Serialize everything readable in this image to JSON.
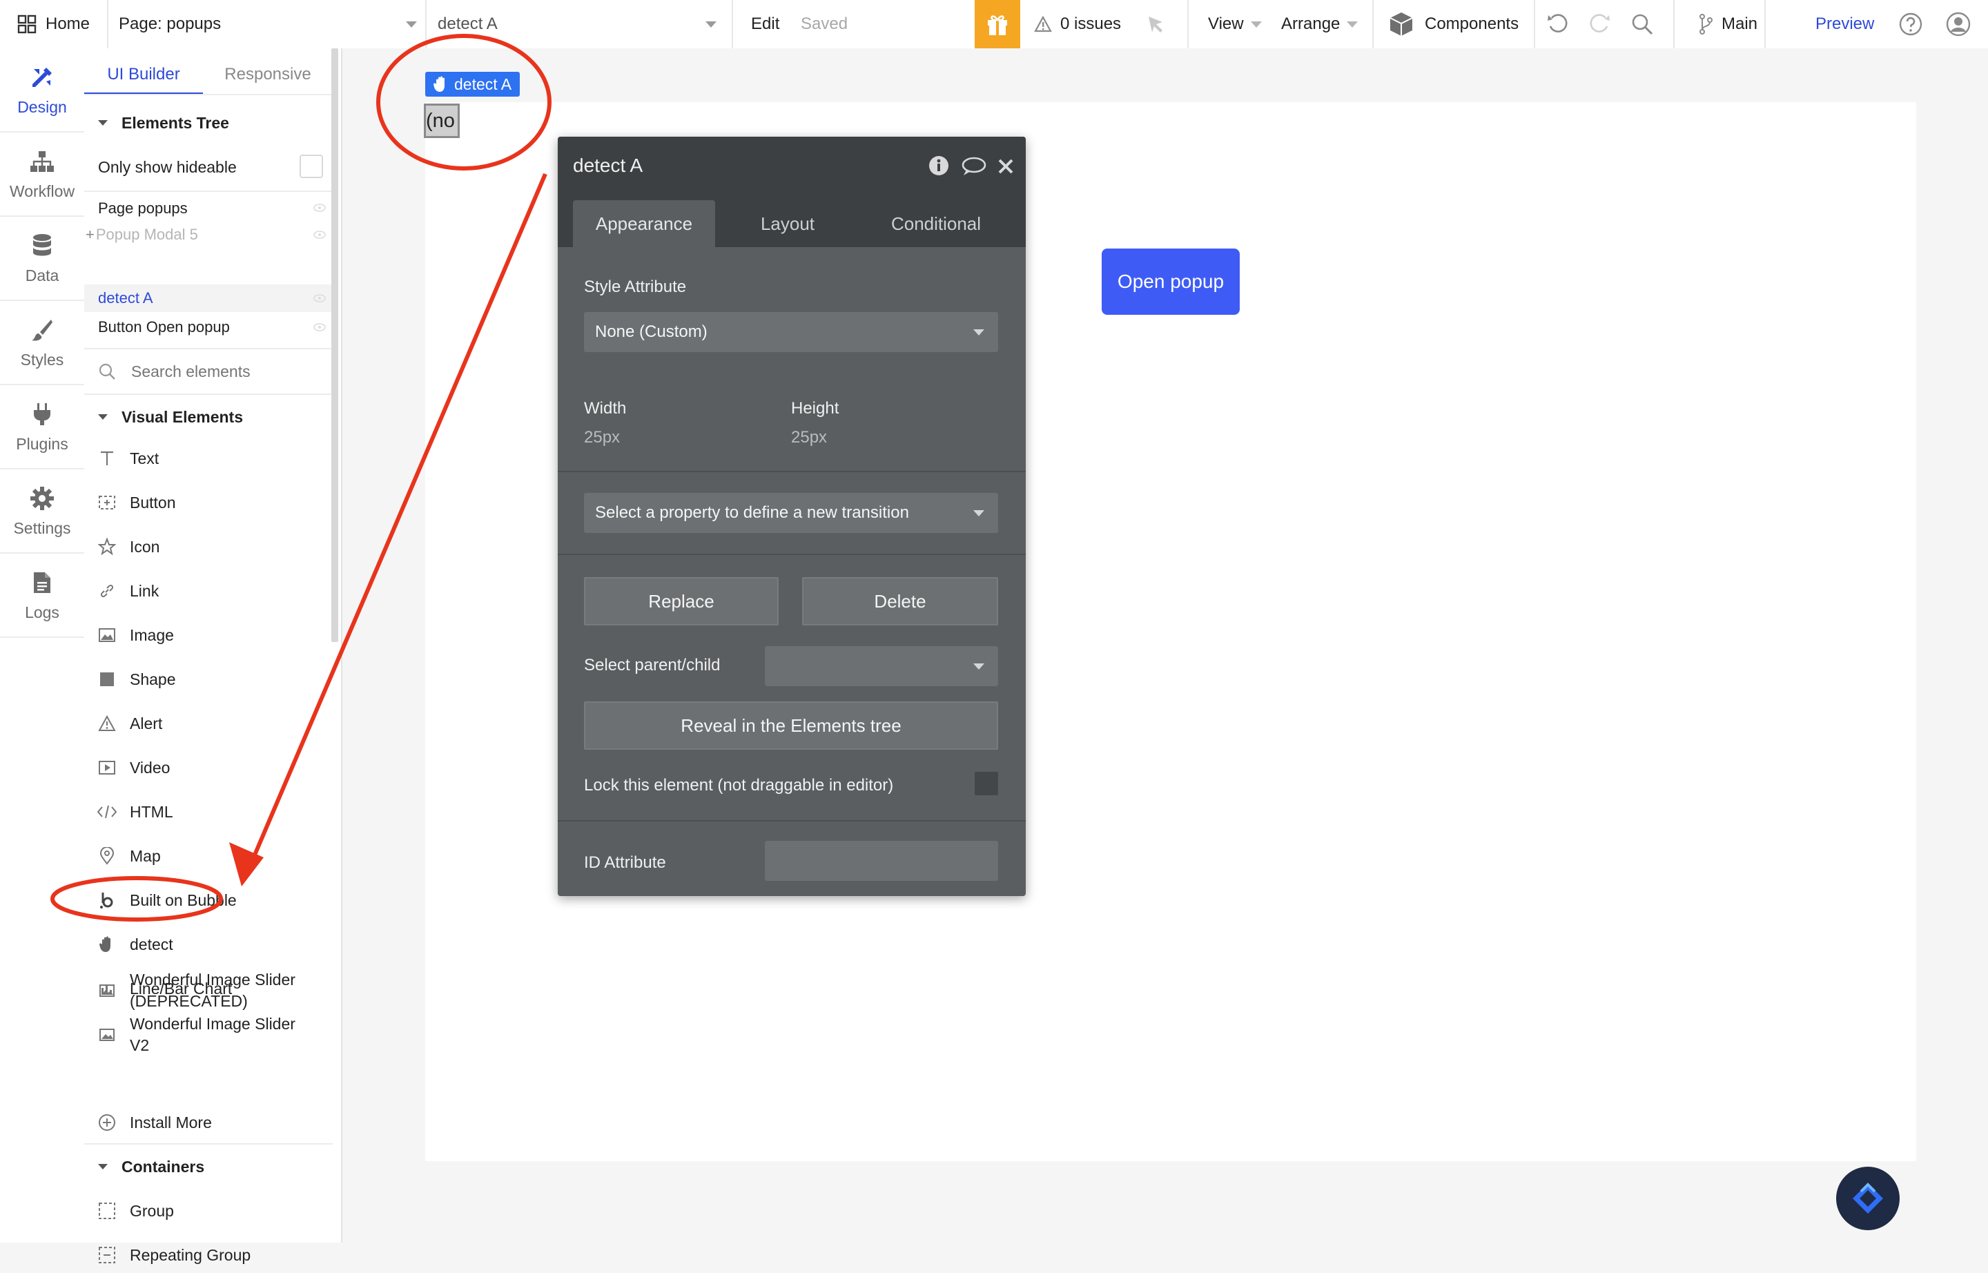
{
  "topbar": {
    "home_label": "Home",
    "page_selector": "Page: popups",
    "element_selector": "detect A",
    "edit_label": "Edit",
    "saved_label": "Saved",
    "issues_label": "0 issues",
    "view_label": "View",
    "arrange_label": "Arrange",
    "components_label": "Components",
    "branch_label": "Main",
    "preview_label": "Preview",
    "gift_color": "#f5a623"
  },
  "rail": {
    "items": [
      {
        "label": "Design",
        "icon": "design-icon"
      },
      {
        "label": "Workflow",
        "icon": "workflow-icon"
      },
      {
        "label": "Data",
        "icon": "data-icon"
      },
      {
        "label": "Styles",
        "icon": "styles-icon"
      },
      {
        "label": "Plugins",
        "icon": "plugins-icon"
      },
      {
        "label": "Settings",
        "icon": "settings-icon"
      },
      {
        "label": "Logs",
        "icon": "logs-icon"
      }
    ]
  },
  "panel": {
    "tabs": [
      "UI Builder",
      "Responsive"
    ],
    "elements_tree_label": "Elements Tree",
    "only_hideable_label": "Only show hideable",
    "tree": [
      "Page popups",
      "Popup Modal 5",
      "detect A",
      "Button Open popup"
    ],
    "search_placeholder": "Search elements",
    "visual_elements_label": "Visual Elements",
    "visual_elements": [
      {
        "label": "Text",
        "icon": "text-icon"
      },
      {
        "label": "Button",
        "icon": "button-icon"
      },
      {
        "label": "Icon",
        "icon": "star-icon"
      },
      {
        "label": "Link",
        "icon": "link-icon"
      },
      {
        "label": "Image",
        "icon": "image-icon"
      },
      {
        "label": "Shape",
        "icon": "shape-icon"
      },
      {
        "label": "Alert",
        "icon": "alert-icon"
      },
      {
        "label": "Video",
        "icon": "video-icon"
      },
      {
        "label": "HTML",
        "icon": "html-icon"
      },
      {
        "label": "Map",
        "icon": "map-pin-icon"
      },
      {
        "label": "Built on Bubble",
        "icon": "bubble-icon"
      },
      {
        "label": "detect",
        "icon": "hand-icon"
      },
      {
        "label": "Line/Bar Chart",
        "icon": "chart-icon"
      }
    ],
    "slider_deprecated_l1": "Wonderful Image Slider",
    "slider_deprecated_l2": "(DEPRECATED)",
    "slider_v2_l1": "Wonderful Image Slider",
    "slider_v2_l2": "V2",
    "install_more_label": "Install More",
    "containers_label": "Containers",
    "containers": [
      {
        "label": "Group",
        "icon": "group-icon"
      },
      {
        "label": "Repeating Group",
        "icon": "repeating-group-icon"
      }
    ]
  },
  "canvas": {
    "element_tag": "detect A",
    "element_placeholder": "(no",
    "open_popup_label": "Open popup",
    "open_popup_color": "#3e5cf5"
  },
  "editor": {
    "title": "detect A",
    "tabs": [
      "Appearance",
      "Layout",
      "Conditional"
    ],
    "style_attribute_label": "Style Attribute",
    "style_value": "None (Custom)",
    "width_label": "Width",
    "width_value": "25px",
    "height_label": "Height",
    "height_value": "25px",
    "transition_placeholder": "Select a property to define a new transition",
    "replace_label": "Replace",
    "delete_label": "Delete",
    "parent_child_label": "Select parent/child",
    "reveal_label": "Reveal in the Elements tree",
    "lock_label": "Lock this element (not draggable in editor)",
    "id_attribute_label": "ID Attribute"
  }
}
